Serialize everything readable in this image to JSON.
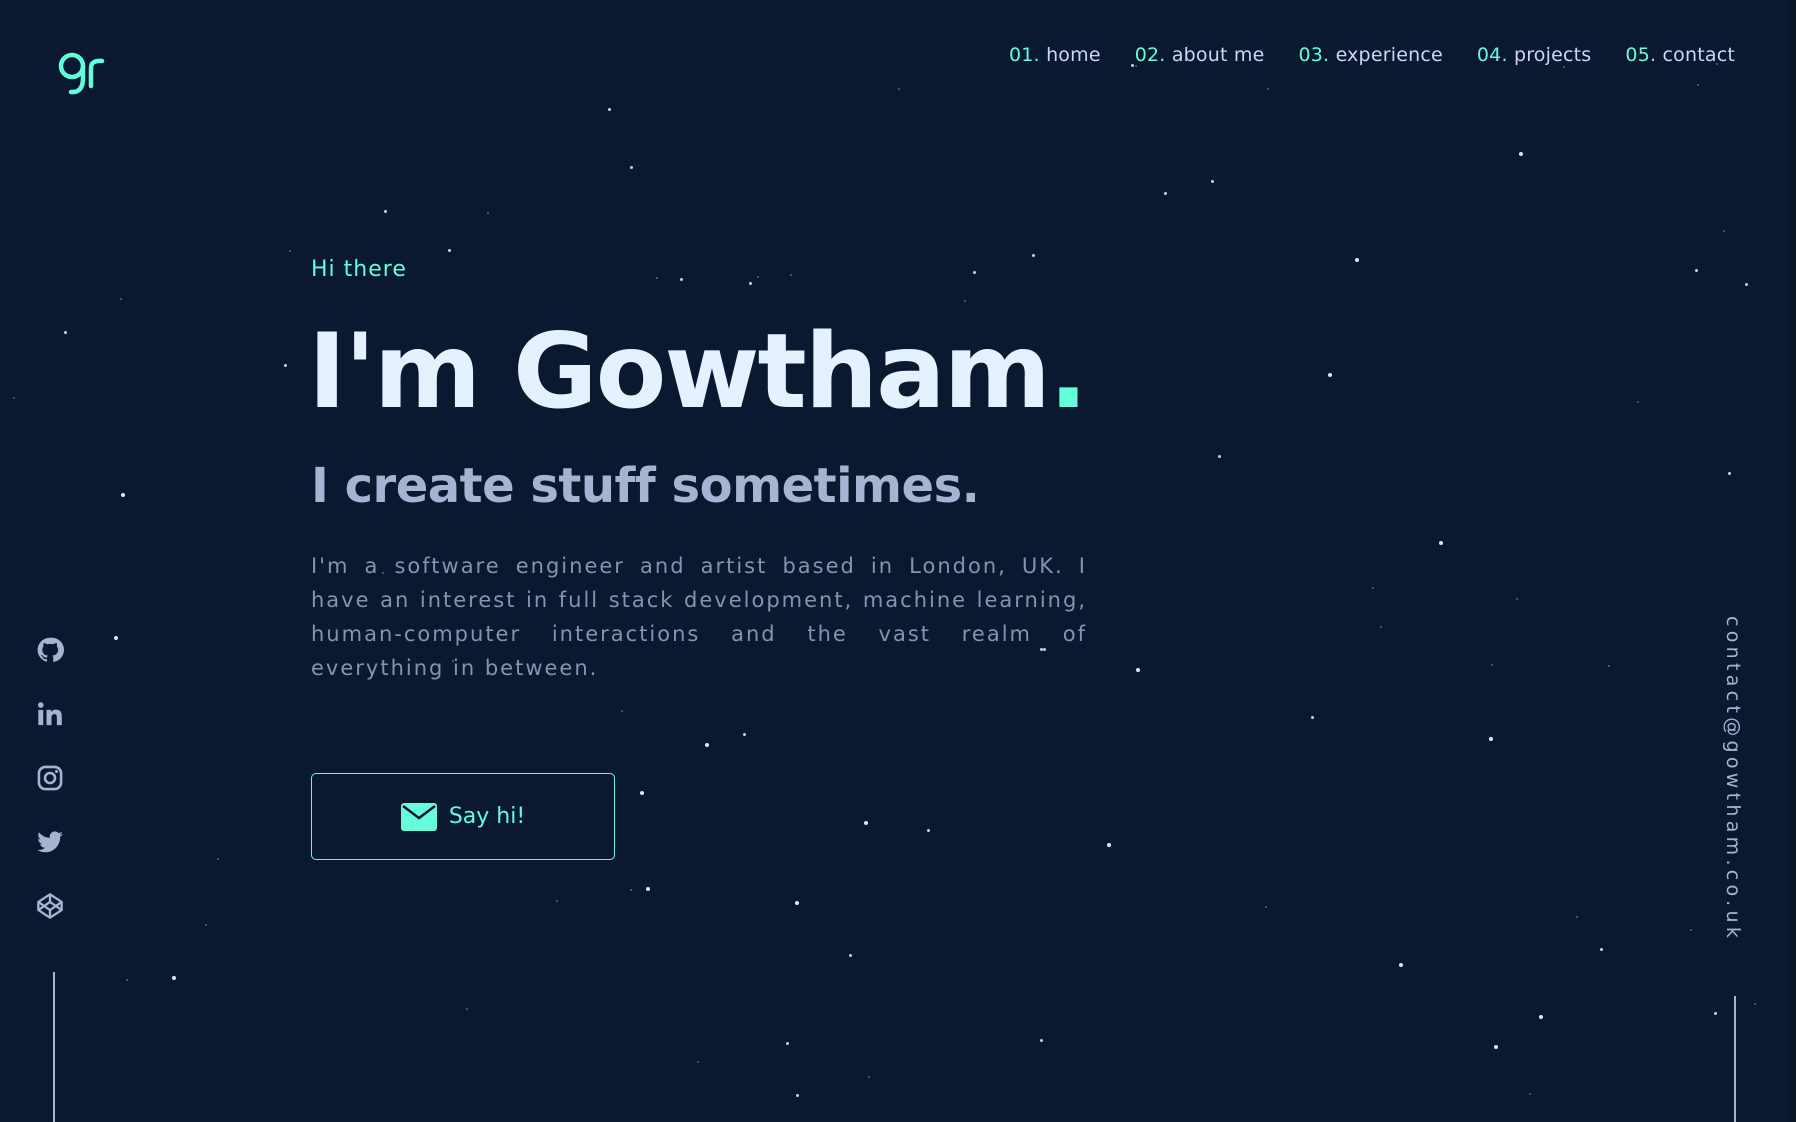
{
  "brand": {
    "logo_text": "gr",
    "accent_color": "#64ffda",
    "background_color": "#0a192f"
  },
  "nav": {
    "items": [
      {
        "num": "01.",
        "label": "home"
      },
      {
        "num": "02.",
        "label": "about me"
      },
      {
        "num": "03.",
        "label": "experience"
      },
      {
        "num": "04.",
        "label": "projects"
      },
      {
        "num": "05.",
        "label": "contact"
      }
    ]
  },
  "hero": {
    "greeting": "Hi there",
    "headline": "I'm Gowtham",
    "headline_dot": ".",
    "subheadline": "I create stuff sometimes.",
    "bio": "I'm a software engineer and artist based in London, UK. I have an interest in full stack development, machine learning, human-computer interactions and the vast realm of everything in between.",
    "cta_label": "Say hi!",
    "cta_icon": "envelope-icon"
  },
  "social": {
    "icons": [
      "github-icon",
      "linkedin-icon",
      "instagram-icon",
      "twitter-icon",
      "codepen-icon"
    ]
  },
  "email": {
    "address": "contact@gowtham.co.uk"
  }
}
